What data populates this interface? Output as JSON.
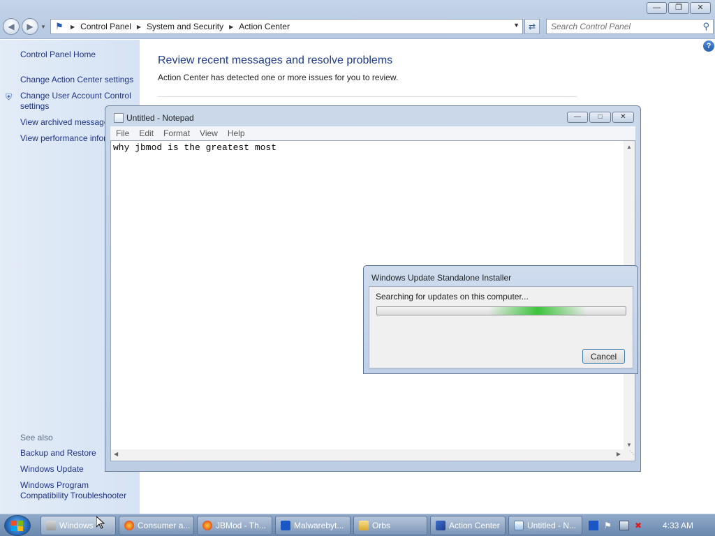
{
  "control_panel": {
    "breadcrumbs": [
      "Control Panel",
      "System and Security",
      "Action Center"
    ],
    "search_placeholder": "Search Control Panel",
    "sidebar": {
      "links": [
        {
          "label": "Control Panel Home"
        },
        {
          "label": "Change Action Center settings"
        },
        {
          "label": "Change User Account Control settings"
        },
        {
          "label": "View archived messages"
        },
        {
          "label": "View performance information"
        }
      ],
      "see_also_label": "See also",
      "see_also": [
        {
          "label": "Backup and Restore"
        },
        {
          "label": "Windows Update"
        },
        {
          "label": "Windows Program Compatibility Troubleshooter"
        }
      ]
    },
    "heading": "Review recent messages and resolve problems",
    "subtext": "Action Center has detected one or more issues for you to review."
  },
  "notepad": {
    "title": "Untitled - Notepad",
    "menu": [
      "File",
      "Edit",
      "Format",
      "View",
      "Help"
    ],
    "content": "why jbmod is the greatest most"
  },
  "dialog": {
    "title": "Windows Update Standalone Installer",
    "message": "Searching for updates on this computer...",
    "cancel_label": "Cancel",
    "progress": "indeterminate"
  },
  "taskbar": {
    "items": [
      {
        "label": "Windows",
        "icon": "windows-explorer-icon"
      },
      {
        "label": "Consumer a...",
        "icon": "firefox-icon"
      },
      {
        "label": "JBMod - Th...",
        "icon": "firefox-icon"
      },
      {
        "label": "Malwarebyt...",
        "icon": "malwarebytes-icon"
      },
      {
        "label": "Orbs",
        "icon": "folder-icon"
      },
      {
        "label": "Action Center",
        "icon": "action-center-flag-icon"
      },
      {
        "label": "Untitled - N...",
        "icon": "notepad-icon"
      }
    ],
    "clock": "4:33 AM"
  },
  "colors": {
    "link": "#1e3287",
    "heading": "#1e3a8a",
    "sidebar_bg": "#d6e3f4",
    "progress_glow": "#3cc43c",
    "taskbar": "#6a87ad"
  }
}
